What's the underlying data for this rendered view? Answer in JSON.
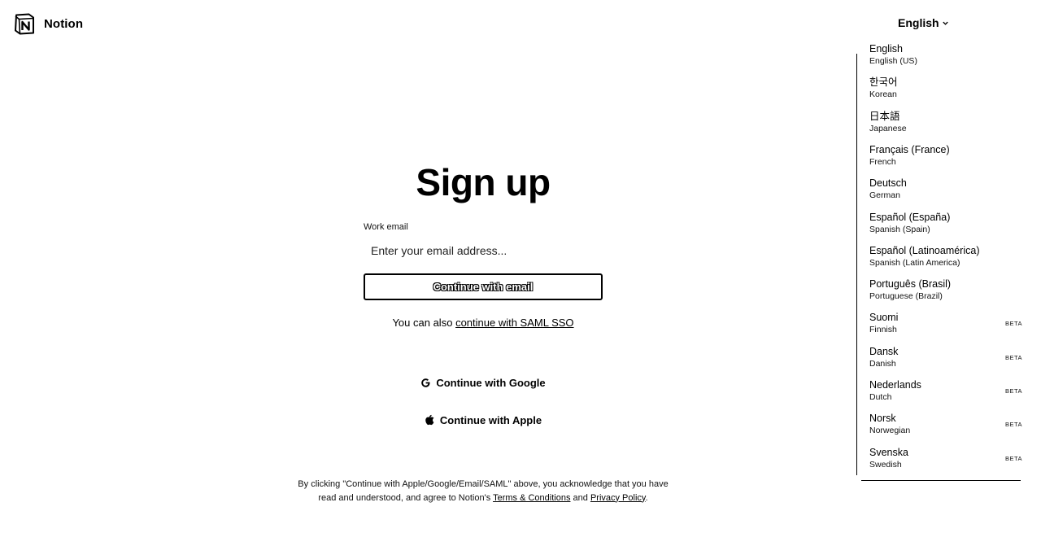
{
  "header": {
    "brand_name": "Notion",
    "language_button": "English"
  },
  "form": {
    "title": "Sign up",
    "email_label": "Work email",
    "email_placeholder": "Enter your email address...",
    "continue_button": "Continue with email",
    "saml_prefix": "You can also",
    "saml_link": "continue with SAML SSO",
    "google_button": "Continue with Google",
    "apple_button": "Continue with Apple"
  },
  "legal": {
    "text_1": "By clicking \"Continue with Apple/Google/Email/SAML\" above, you acknowledge that you have read and understood, and agree to Notion's",
    "terms_link": "Terms & Conditions",
    "and": "and",
    "privacy_link": "Privacy Policy",
    "period": "."
  },
  "language_menu": {
    "beta_label": "BETA",
    "items": [
      {
        "native": "English",
        "english": "English (US)",
        "beta": false
      },
      {
        "native": "한국어",
        "english": "Korean",
        "beta": false
      },
      {
        "native": "日本語",
        "english": "Japanese",
        "beta": false
      },
      {
        "native": "Français (France)",
        "english": "French",
        "beta": false
      },
      {
        "native": "Deutsch",
        "english": "German",
        "beta": false
      },
      {
        "native": "Español (España)",
        "english": "Spanish (Spain)",
        "beta": false
      },
      {
        "native": "Español (Latinoamérica)",
        "english": "Spanish (Latin America)",
        "beta": false
      },
      {
        "native": "Português (Brasil)",
        "english": "Portuguese (Brazil)",
        "beta": false
      },
      {
        "native": "Suomi",
        "english": "Finnish",
        "beta": true
      },
      {
        "native": "Dansk",
        "english": "Danish",
        "beta": true
      },
      {
        "native": "Nederlands",
        "english": "Dutch",
        "beta": true
      },
      {
        "native": "Norsk",
        "english": "Norwegian",
        "beta": true
      },
      {
        "native": "Svenska",
        "english": "Swedish",
        "beta": true
      }
    ]
  }
}
